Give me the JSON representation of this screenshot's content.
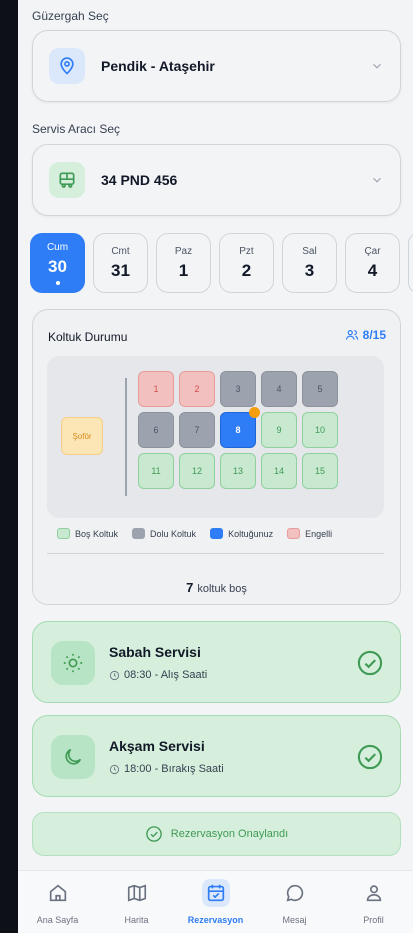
{
  "route": {
    "label": "Güzergah Seç",
    "value": "Pendik - Ataşehir",
    "icon": "location-pin-icon"
  },
  "vehicle": {
    "label": "Servis Aracı Seç",
    "value": "34 PND 456",
    "icon": "bus-icon"
  },
  "days": [
    {
      "name": "Cum",
      "date": "30",
      "active": true
    },
    {
      "name": "Cmt",
      "date": "31",
      "active": false
    },
    {
      "name": "Paz",
      "date": "1",
      "active": false
    },
    {
      "name": "Pzt",
      "date": "2",
      "active": false
    },
    {
      "name": "Sal",
      "date": "3",
      "active": false
    },
    {
      "name": "Çar",
      "date": "4",
      "active": false
    }
  ],
  "seating": {
    "title": "Koltuk Durumu",
    "occupancy": "8/15",
    "driver_label": "Şoför",
    "seats": [
      {
        "number": "1",
        "status": "disabled"
      },
      {
        "number": "2",
        "status": "disabled"
      },
      {
        "number": "3",
        "status": "full"
      },
      {
        "number": "4",
        "status": "full"
      },
      {
        "number": "5",
        "status": "full"
      },
      {
        "number": "6",
        "status": "full"
      },
      {
        "number": "7",
        "status": "full"
      },
      {
        "number": "8",
        "status": "mine"
      },
      {
        "number": "9",
        "status": "empty"
      },
      {
        "number": "10",
        "status": "empty"
      },
      {
        "number": "11",
        "status": "empty"
      },
      {
        "number": "12",
        "status": "empty"
      },
      {
        "number": "13",
        "status": "empty"
      },
      {
        "number": "14",
        "status": "empty"
      },
      {
        "number": "15",
        "status": "empty"
      }
    ],
    "legend": {
      "empty": "Boş Koltuk",
      "full": "Dolu Koltuk",
      "mine": "Koltuğunuz",
      "disabled": "Engelli"
    },
    "free_count": "7",
    "free_label": "koltuk boş"
  },
  "services": [
    {
      "title": "Sabah Servisi",
      "subtitle": "08:30 - Alış Saati",
      "icon": "sun-icon"
    },
    {
      "title": "Akşam Servisi",
      "subtitle": "18:00 - Bırakış Saati",
      "icon": "moon-icon"
    }
  ],
  "confirmation": "Rezervasyon Onaylandı",
  "tabs": [
    {
      "label": "Ana Sayfa",
      "icon": "home-icon"
    },
    {
      "label": "Harita",
      "icon": "map-icon"
    },
    {
      "label": "Rezervasyon",
      "icon": "calendar-check-icon",
      "active": true
    },
    {
      "label": "Mesaj",
      "icon": "message-icon"
    },
    {
      "label": "Profil",
      "icon": "user-icon"
    }
  ],
  "colors": {
    "accent": "#2f7df6",
    "success": "#3f9a55",
    "seat_empty": "#c8e8cf",
    "seat_full": "#9ca3af",
    "seat_disabled": "#f3c0c0",
    "driver": "#fde6b6"
  }
}
